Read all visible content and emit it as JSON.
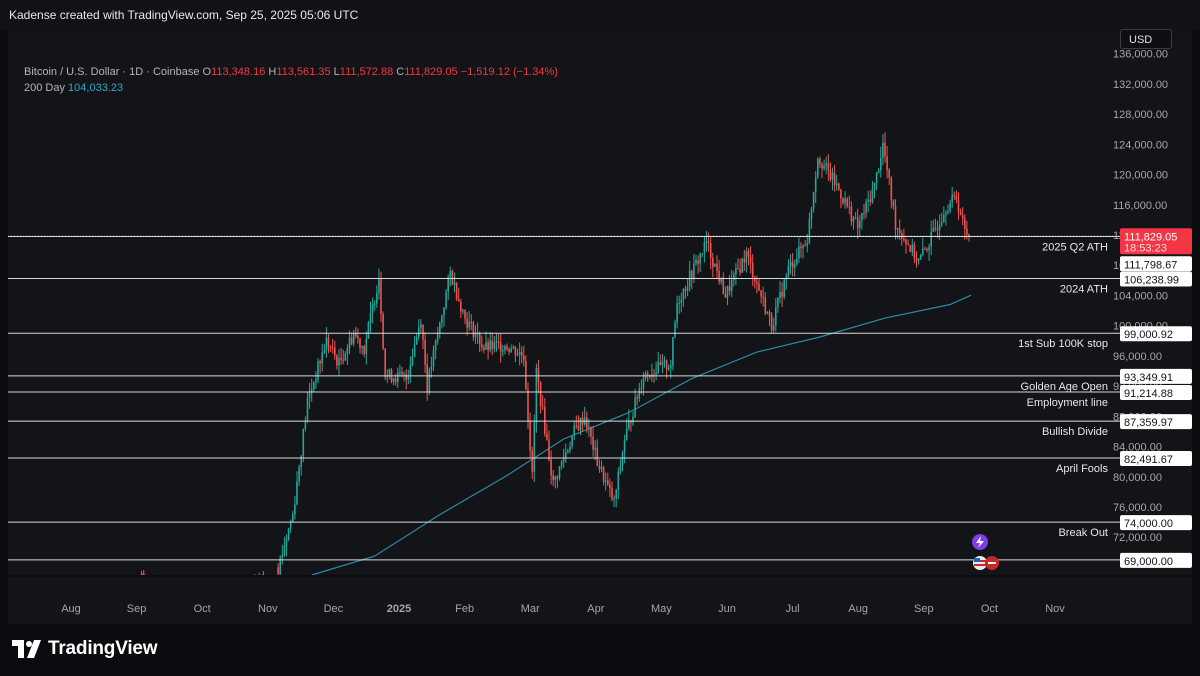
{
  "header": {
    "attribution": "Kadense created with TradingView.com, Sep 25, 2025 05:06 UTC"
  },
  "legend": {
    "symbol": "Bitcoin / U.S. Dollar · 1D · Coinbase",
    "o_label": "O",
    "o_value": "113,348.16",
    "h_label": "H",
    "h_value": "113,561.35",
    "l_label": "L",
    "l_value": "111,572.88",
    "c_label": "C",
    "c_value": "111,829.05",
    "change": "−1,519.12 (−1.34%)",
    "ma_label": "200 Day",
    "ma_value": "104,033.23"
  },
  "currency_button": "USD",
  "footer": {
    "brand": "TradingView"
  },
  "colors": {
    "up": "#26a69a",
    "down": "#ef5350",
    "ma": "#2a8aa6",
    "price_tag": "#f23645",
    "background": "#131417"
  },
  "chart_data": {
    "type": "candlestick",
    "title": "Bitcoin / U.S. Dollar · 1D · Coinbase",
    "ylim": [
      67000,
      139000
    ],
    "y_ticks": [
      "136,000.00",
      "132,000.00",
      "128,000.00",
      "124,000.00",
      "120,000.00",
      "116,000.00",
      "112,000.00",
      "108,000.00",
      "104,000.00",
      "100,000.00",
      "96,000.00",
      "92,000.00",
      "88,000.00",
      "84,000.00",
      "80,000.00",
      "76,000.00",
      "72,000.00"
    ],
    "x_labels": [
      "Aug",
      "Sep",
      "Oct",
      "Nov",
      "Dec",
      "2025",
      "Feb",
      "Mar",
      "Apr",
      "May",
      "Jun",
      "Jul",
      "Aug",
      "Sep",
      "Oct",
      "Nov"
    ],
    "current_price": {
      "value": "111,829.05",
      "countdown": "18:53:23"
    },
    "levels": [
      {
        "label": "2025 Q2 ATH",
        "value": "111,798.67"
      },
      {
        "label": "2024 ATH",
        "value": "106,238.99"
      },
      {
        "label": "1st Sub 100K stop",
        "value": "99,000.92"
      },
      {
        "label": "Golden Age Open",
        "value": "93,349.91"
      },
      {
        "label": "Employment line",
        "value": "91,214.88"
      },
      {
        "label": "Bullish Divide",
        "value": "87,359.97"
      },
      {
        "label": "April Fools",
        "value": "82,491.67"
      },
      {
        "label": "Break Out",
        "value": "74,000.00"
      },
      {
        "label": "",
        "value": "69,000.00"
      }
    ],
    "price_path": [
      [
        "2024-10-30",
        68000
      ],
      [
        "2024-11-06",
        75000
      ],
      [
        "2024-11-13",
        90000
      ],
      [
        "2024-11-22",
        98000
      ],
      [
        "2024-11-28",
        95000
      ],
      [
        "2024-12-05",
        99000
      ],
      [
        "2024-12-10",
        97000
      ],
      [
        "2024-12-17",
        106500
      ],
      [
        "2024-12-20",
        93500
      ],
      [
        "2024-12-30",
        93000
      ],
      [
        "2025-01-06",
        101000
      ],
      [
        "2025-01-09",
        92000
      ],
      [
        "2025-01-20",
        107000
      ],
      [
        "2025-01-27",
        101000
      ],
      [
        "2025-02-02",
        98500
      ],
      [
        "2025-02-05",
        97000
      ],
      [
        "2025-02-15",
        97500
      ],
      [
        "2025-02-24",
        96000
      ],
      [
        "2025-02-28",
        80000
      ],
      [
        "2025-03-02",
        94000
      ],
      [
        "2025-03-10",
        79000
      ],
      [
        "2025-03-20",
        86000
      ],
      [
        "2025-03-25",
        88000
      ],
      [
        "2025-03-31",
        82000
      ],
      [
        "2025-04-08",
        76500
      ],
      [
        "2025-04-13",
        85000
      ],
      [
        "2025-04-22",
        93500
      ],
      [
        "2025-05-05",
        95000
      ],
      [
        "2025-05-08",
        103000
      ],
      [
        "2025-05-22",
        111000
      ],
      [
        "2025-05-31",
        104000
      ],
      [
        "2025-06-10",
        109500
      ],
      [
        "2025-06-22",
        100000
      ],
      [
        "2025-06-30",
        107500
      ],
      [
        "2025-07-09",
        111500
      ],
      [
        "2025-07-14",
        122500
      ],
      [
        "2025-07-24",
        118000
      ],
      [
        "2025-08-02",
        113000
      ],
      [
        "2025-08-10",
        118500
      ],
      [
        "2025-08-14",
        124000
      ],
      [
        "2025-08-20",
        113500
      ],
      [
        "2025-08-31",
        108500
      ],
      [
        "2025-09-05",
        111000
      ],
      [
        "2025-09-13",
        115800
      ],
      [
        "2025-09-18",
        117000
      ],
      [
        "2025-09-22",
        112500
      ],
      [
        "2025-09-25",
        111829
      ]
    ],
    "ma_series_name": "200 Day",
    "ma_path": [
      [
        "2024-11-15",
        67000
      ],
      [
        "2024-12-15",
        69500
      ],
      [
        "2025-01-15",
        75000
      ],
      [
        "2025-02-15",
        80000
      ],
      [
        "2025-03-15",
        85000
      ],
      [
        "2025-04-15",
        88500
      ],
      [
        "2025-05-15",
        93000
      ],
      [
        "2025-06-15",
        96500
      ],
      [
        "2025-07-15",
        98500
      ],
      [
        "2025-08-15",
        101000
      ],
      [
        "2025-09-15",
        102800
      ],
      [
        "2025-09-25",
        104033
      ]
    ]
  }
}
